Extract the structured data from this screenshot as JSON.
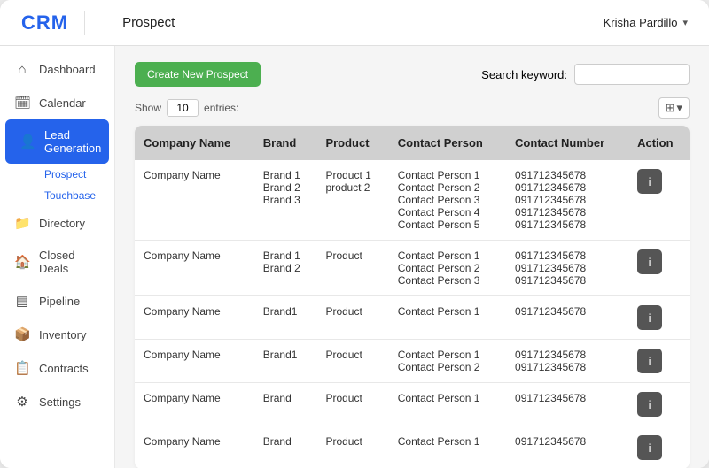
{
  "topBar": {
    "logo": "CRM",
    "title": "Prospect",
    "user": "Krisha Pardillo",
    "userChevron": "▾"
  },
  "sidebar": {
    "items": [
      {
        "id": "dashboard",
        "label": "Dashboard",
        "icon": "⌂"
      },
      {
        "id": "calendar",
        "label": "Calendar",
        "icon": "📅"
      },
      {
        "id": "lead-generation",
        "label": "Lead Generation",
        "icon": "👤",
        "active": true
      },
      {
        "id": "directory",
        "label": "Directory",
        "icon": "📁"
      },
      {
        "id": "closed-deals",
        "label": "Closed Deals",
        "icon": "🏠"
      },
      {
        "id": "pipeline",
        "label": "Pipeline",
        "icon": "📊"
      },
      {
        "id": "inventory",
        "label": "Inventory",
        "icon": "📦"
      },
      {
        "id": "contracts",
        "label": "Contracts",
        "icon": "📋"
      },
      {
        "id": "settings",
        "label": "Settings",
        "icon": "⚙"
      }
    ],
    "subItems": [
      {
        "id": "prospect",
        "label": "Prospect",
        "active": true
      },
      {
        "id": "touchbase",
        "label": "Touchbase"
      }
    ]
  },
  "toolbar": {
    "createBtn": "Create New Prospect",
    "searchLabel": "Search keyword:",
    "searchPlaceholder": "",
    "showLabel": "Show",
    "showValue": "10",
    "entriesLabel": "entries:"
  },
  "table": {
    "columns": [
      "Company Name",
      "Brand",
      "Product",
      "Contact Person",
      "Contact Number",
      "Action"
    ],
    "rows": [
      {
        "companyName": "Company Name",
        "brand": "Brand 1\nBrand 2\nBrand 3",
        "product": "Product 1\nproduct 2",
        "contactPerson": "Contact Person 1\nContact Person 2\nContact Person 3\nContact Person 4\nContact Person 5",
        "contactNumber": "091712345678\n091712345678\n091712345678\n091712345678\n091712345678"
      },
      {
        "companyName": "Company Name",
        "brand": "Brand 1\nBrand 2",
        "product": "Product",
        "contactPerson": "Contact Person 1\nContact Person 2\nContact Person 3",
        "contactNumber": "091712345678\n091712345678\n091712345678"
      },
      {
        "companyName": "Company Name",
        "brand": "Brand1",
        "product": "Product",
        "contactPerson": "Contact Person 1",
        "contactNumber": "091712345678"
      },
      {
        "companyName": "Company Name",
        "brand": "Brand1",
        "product": "Product",
        "contactPerson": "Contact Person 1\nContact Person 2",
        "contactNumber": "091712345678\n091712345678"
      },
      {
        "companyName": "Company Name",
        "brand": "Brand",
        "product": "Product",
        "contactPerson": "Contact Person 1",
        "contactNumber": "091712345678"
      },
      {
        "companyName": "Company Name",
        "brand": "Brand",
        "product": "Product",
        "contactPerson": "Contact Person 1",
        "contactNumber": "091712345678"
      }
    ],
    "actionIcon": "i"
  }
}
